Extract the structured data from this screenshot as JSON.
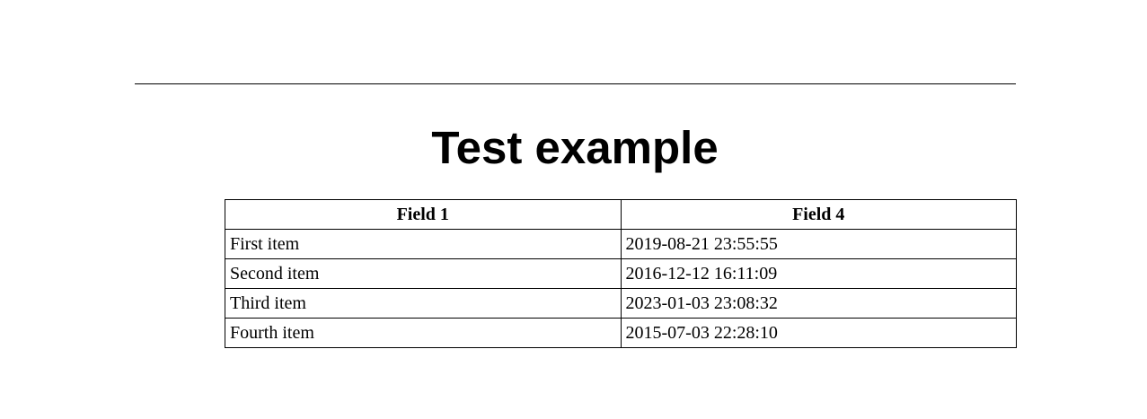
{
  "page": {
    "title": "Test example"
  },
  "table": {
    "headers": [
      "Field 1",
      "Field 4"
    ],
    "rows": [
      [
        "First item",
        "2019-08-21 23:55:55"
      ],
      [
        "Second item",
        "2016-12-12 16:11:09"
      ],
      [
        "Third item",
        "2023-01-03 23:08:32"
      ],
      [
        "Fourth item",
        "2015-07-03 22:28:10"
      ]
    ]
  }
}
